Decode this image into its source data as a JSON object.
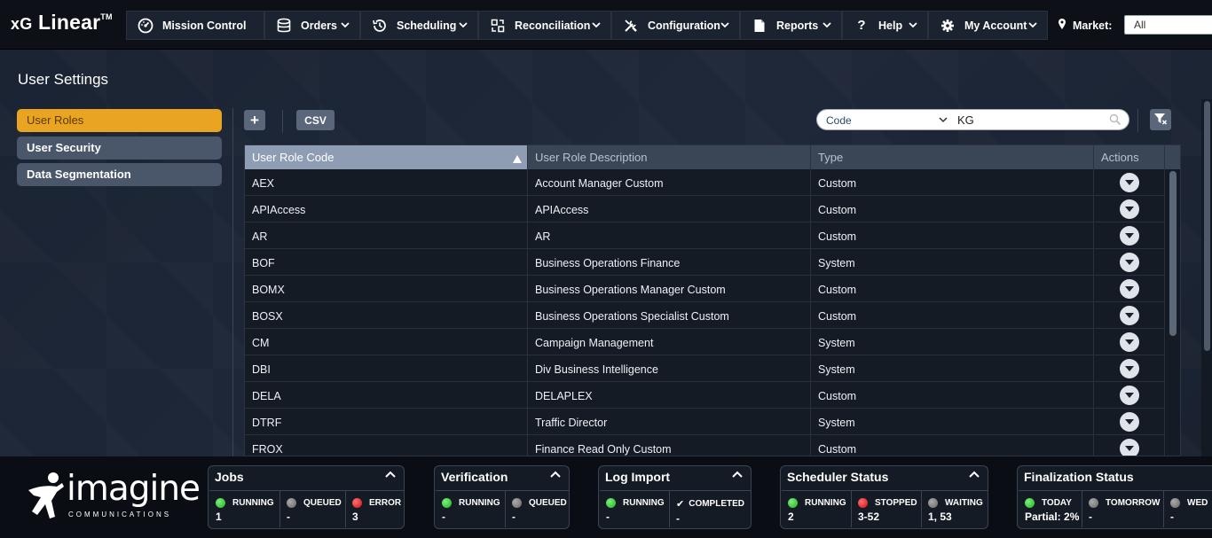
{
  "app": {
    "brand_prefix": "xG",
    "brand_name": "Linear",
    "brand_tm": "TM"
  },
  "nav": [
    {
      "label": "Mission Control",
      "icon": "dashboard-icon",
      "dropdown": false
    },
    {
      "label": "Orders",
      "icon": "database-icon",
      "dropdown": true
    },
    {
      "label": "Scheduling",
      "icon": "history-icon",
      "dropdown": true
    },
    {
      "label": "Reconciliation",
      "icon": "reconcile-icon",
      "dropdown": true
    },
    {
      "label": "Configuration",
      "icon": "tools-icon",
      "dropdown": true
    },
    {
      "label": "Reports",
      "icon": "document-icon",
      "dropdown": true
    },
    {
      "label": "Help",
      "icon": "question-icon",
      "dropdown": true
    },
    {
      "label": "My Account",
      "icon": "gear-icon",
      "dropdown": true
    }
  ],
  "market": {
    "label": "Market:",
    "value": "All"
  },
  "page": {
    "title": "User Settings"
  },
  "sidebar": {
    "items": [
      {
        "label": "User Roles",
        "active": true
      },
      {
        "label": "User Security",
        "active": false
      },
      {
        "label": "Data Segmentation",
        "active": false
      }
    ]
  },
  "toolbar": {
    "add_label": "+",
    "csv_label": "CSV"
  },
  "filter": {
    "field": "Code",
    "value": "KG"
  },
  "table": {
    "columns": [
      "User Role Code",
      "User Role Description",
      "Type",
      "Actions"
    ],
    "sorted_column": "User Role Code",
    "rows": [
      [
        "AEX",
        "Account Manager Custom",
        "Custom"
      ],
      [
        "APIAccess",
        "APIAccess",
        "Custom"
      ],
      [
        "AR",
        "AR",
        "Custom"
      ],
      [
        "BOF",
        "Business Operations Finance",
        "System"
      ],
      [
        "BOMX",
        "Business Operations Manager Custom",
        "Custom"
      ],
      [
        "BOSX",
        "Business Operations Specialist Custom",
        "Custom"
      ],
      [
        "CM",
        "Campaign Management",
        "System"
      ],
      [
        "DBI",
        "Div Business Intelligence",
        "System"
      ],
      [
        "DELA",
        "DELAPLEX",
        "Custom"
      ],
      [
        "DTRF",
        "Traffic Director",
        "System"
      ],
      [
        "FROX",
        "Finance Read Only Custom",
        "Custom"
      ]
    ]
  },
  "logo": {
    "word": "imagine",
    "sub": "COMMUNICATIONS"
  },
  "status": {
    "jobs": {
      "title": "Jobs",
      "cells": [
        {
          "label": "RUNNING",
          "value": "1",
          "indicator": "green"
        },
        {
          "label": "QUEUED",
          "value": "-",
          "indicator": "grey"
        },
        {
          "label": "ERROR",
          "value": "3",
          "indicator": "red"
        }
      ]
    },
    "verification": {
      "title": "Verification",
      "cells": [
        {
          "label": "RUNNING",
          "value": "-",
          "indicator": "green"
        },
        {
          "label": "QUEUED",
          "value": "-",
          "indicator": "grey"
        }
      ]
    },
    "log_import": {
      "title": "Log Import",
      "cells": [
        {
          "label": "RUNNING",
          "value": "-",
          "indicator": "green"
        },
        {
          "label": "COMPLETED",
          "value": "-",
          "indicator": "check"
        }
      ]
    },
    "scheduler": {
      "title": "Scheduler Status",
      "cells": [
        {
          "label": "RUNNING",
          "value": "2",
          "indicator": "green"
        },
        {
          "label": "STOPPED",
          "value": "3-52",
          "indicator": "red"
        },
        {
          "label": "WAITING",
          "value": "1, 53",
          "indicator": "grey"
        }
      ]
    },
    "finalization": {
      "title": "Finalization Status",
      "cells": [
        {
          "label": "TODAY",
          "value": "Partial: 2%",
          "indicator": "green"
        },
        {
          "label": "TOMORROW",
          "value": "-",
          "indicator": "grey"
        },
        {
          "label": "WED",
          "value": "-",
          "indicator": "grey"
        }
      ]
    }
  },
  "colors": {
    "accent": "#e9a521",
    "running": "#1db01d",
    "error": "#d01010"
  }
}
